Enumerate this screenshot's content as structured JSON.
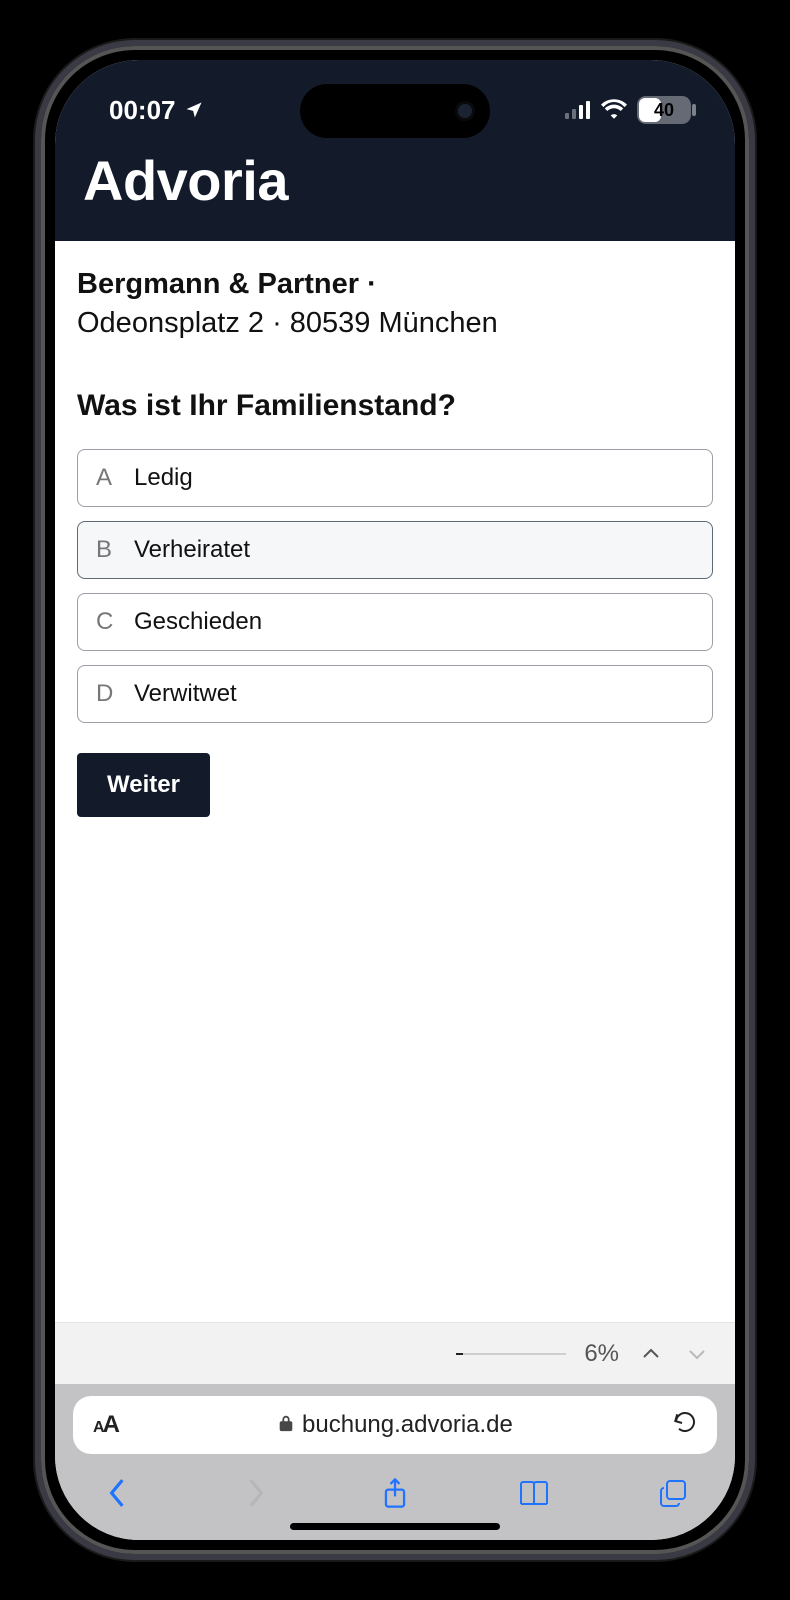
{
  "status": {
    "time": "00:07",
    "battery_percent": "40"
  },
  "app": {
    "title": "Advoria"
  },
  "firm": {
    "name": "Bergmann & Partner",
    "separator": "·",
    "address_line": "Odeonsplatz 2 · 80539 München"
  },
  "question": "Was ist Ihr Familienstand?",
  "options": [
    {
      "letter": "A",
      "label": "Ledig",
      "selected": false
    },
    {
      "letter": "B",
      "label": "Verheiratet",
      "selected": true
    },
    {
      "letter": "C",
      "label": "Geschieden",
      "selected": false
    },
    {
      "letter": "D",
      "label": "Verwitwet",
      "selected": false
    }
  ],
  "continue_label": "Weiter",
  "progress": {
    "percent_label": "6%"
  },
  "browser": {
    "domain": "buchung.advoria.de"
  }
}
